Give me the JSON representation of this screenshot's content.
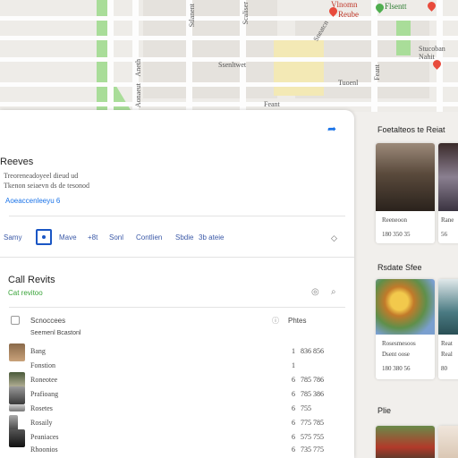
{
  "map": {
    "street_labels": [
      "Stlanent",
      "Scaliser",
      "Aneth",
      "Aonaeut",
      "Ssenltwet",
      "Sneatcn",
      "Tuoenl",
      "Feant",
      "Feant"
    ],
    "place_labels": [
      "Vlnomn",
      "Reube",
      "Flsentt",
      "Stucoban Nahit"
    ]
  },
  "panel": {
    "share_icon": "share-icon",
    "title": "Reeves",
    "description_lines": [
      "Treoreneadoyeel dieud ud",
      "Tkenon seiaevn ds de tesonod"
    ],
    "link": "Aoeaccenleeyu 6",
    "tabs": [
      "Samy",
      "Mave",
      "+8t",
      "Sonl",
      "Contlien",
      "Sbdie",
      "3b ateie"
    ],
    "section_title": "Call Revits",
    "section_subtitle": "Cat revitoo",
    "table_header": {
      "name": "Scnoccees",
      "value": "Phtes"
    },
    "table_subheader": "Seemenl Bcastonl",
    "rows": [
      {
        "name": "Bang",
        "n1": "1",
        "n2": "836 856"
      },
      {
        "name": "Fonstion",
        "n1": "1",
        "n2": ""
      },
      {
        "name": "Roneotee",
        "n1": "6",
        "n2": "785 786"
      },
      {
        "name": "Prafioang",
        "n1": "6",
        "n2": "785 386"
      },
      {
        "name": "Rosetes",
        "n1": "6",
        "n2": "755"
      },
      {
        "name": "Rosaily",
        "n1": "6",
        "n2": "775 785"
      },
      {
        "name": "Peaniaces",
        "n1": "6",
        "n2": "575 755"
      },
      {
        "name": "Rhoonios",
        "n1": "6",
        "n2": "735 775"
      }
    ]
  },
  "right": {
    "section1_title": "Foetalteos te Reiat",
    "section1_cards": [
      {
        "line1": "Reeneoon",
        "line2": "180 350 35"
      },
      {
        "line1": "Rane",
        "line2": "56"
      }
    ],
    "section2_title": "Rsdate Sfee",
    "section2_cards": [
      {
        "line1": "Rosesmesoos",
        "line2": "Dsent oose",
        "line3": "180 380 56"
      },
      {
        "line1": "Reat",
        "line2": "Real",
        "line3": "80"
      }
    ],
    "section3_title": "Plie"
  },
  "colors": {
    "accent": "#1a73e8",
    "green": "#3aa43a",
    "pin": "#e84b3c"
  }
}
